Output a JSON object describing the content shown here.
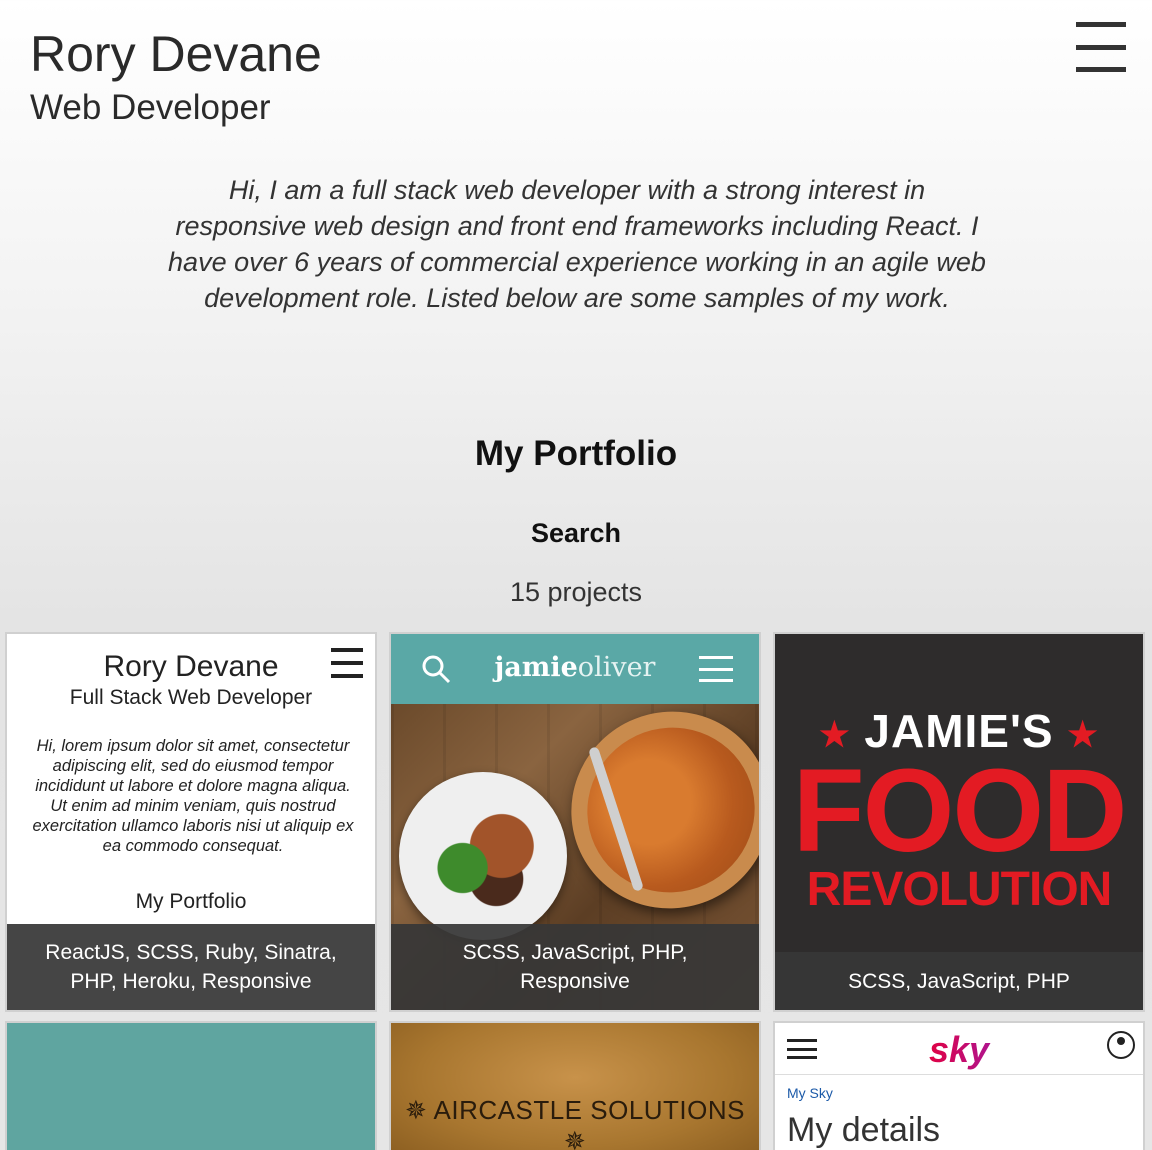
{
  "header": {
    "name": "Rory Devane",
    "role": "Web Developer"
  },
  "intro": "Hi, I am a full stack web developer with a strong interest in responsive web design and front end frameworks including React. I have over 6 years of commercial experience working in an agile web development role. Listed below are some samples of my work.",
  "portfolio": {
    "title": "My Portfolio",
    "search_label": "Search",
    "count": "15 projects"
  },
  "projects": [
    {
      "thumb": {
        "name": "Rory Devane",
        "role": "Full Stack Web Developer",
        "text": "Hi, lorem ipsum dolor sit amet, consectetur adipiscing elit, sed do eiusmod tempor incididunt ut labore et dolore magna aliqua. Ut enim ad minim veniam, quis nostrud exercitation ullamco laboris nisi ut aliquip ex ea commodo consequat.",
        "portfolio": "My Portfolio"
      },
      "tags": "ReactJS, SCSS, Ruby, Sinatra, PHP, Heroku, Responsive"
    },
    {
      "thumb": {
        "logo_bold": "jamie",
        "logo_light": "oliver"
      },
      "tags": "SCSS, JavaScript, PHP, Responsive"
    },
    {
      "thumb": {
        "line1": "JAMIE'S",
        "line2": "FOOD",
        "line3": "REVOLUTION",
        "star": "★"
      },
      "tags": "SCSS, JavaScript, PHP"
    },
    {
      "thumb": {}
    },
    {
      "thumb": {
        "title": "✵ AIRCASTLE SOLUTIONS ✵"
      }
    },
    {
      "thumb": {
        "logo": "sky",
        "breadcrumb": "My Sky",
        "heading": "My details"
      }
    }
  ],
  "colors": {
    "jamie_teal": "#5aa8a6",
    "food_red": "#e31b23",
    "tile4_teal": "#5fa5a0",
    "caption_bg": "#373737"
  }
}
